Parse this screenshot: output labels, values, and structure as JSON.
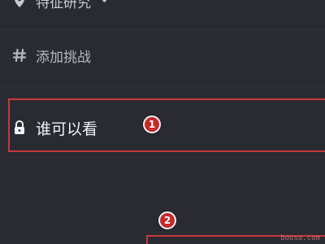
{
  "menu": {
    "items": [
      {
        "label": "特征研究",
        "icon": "location-pin-icon"
      },
      {
        "label": "添加挑战",
        "icon": "hashtag-icon"
      },
      {
        "label": "谁可以看",
        "icon": "lock-icon"
      }
    ]
  },
  "annotations": {
    "markers": [
      "1",
      "2"
    ],
    "highlight_color": "#c33a3a"
  },
  "watermark": "booso.com",
  "colors": {
    "background": "#2a2a32",
    "text_primary": "#f2f2f5",
    "text_secondary": "#b6b6be",
    "marker_fill": "#c32a2a"
  }
}
